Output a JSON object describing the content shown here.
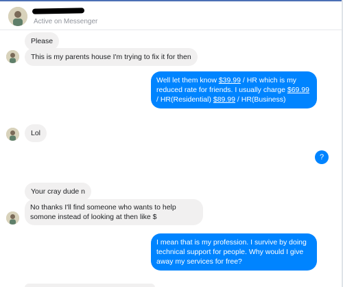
{
  "header": {
    "status": "Active on Messenger"
  },
  "messages": [
    {
      "from": "them",
      "text": "Please"
    },
    {
      "from": "them",
      "text": "This is my parents house I'm trying to fix it for then"
    },
    {
      "from": "me",
      "parts": [
        "Well let them know ",
        "$39.99",
        " / HR which is my reduced rate for friends. I usually charge ",
        "$69.99",
        " / HR(Residential) ",
        "$89.99",
        " / HR(Business)"
      ]
    },
    {
      "from": "them",
      "text": "Lol"
    },
    {
      "from": "me",
      "text": "?"
    },
    {
      "from": "them",
      "text": "Your cray dude n"
    },
    {
      "from": "them",
      "text": "No thanks I'll find someone who wants to help somone instead of looking at then like $"
    },
    {
      "from": "me",
      "text": "I mean that is my profession. I survive by doing technical support for people. Why would I give away my services for free?"
    }
  ],
  "colors": {
    "accent": "#0084ff",
    "incoming_bubble": "#f1f0f0"
  }
}
